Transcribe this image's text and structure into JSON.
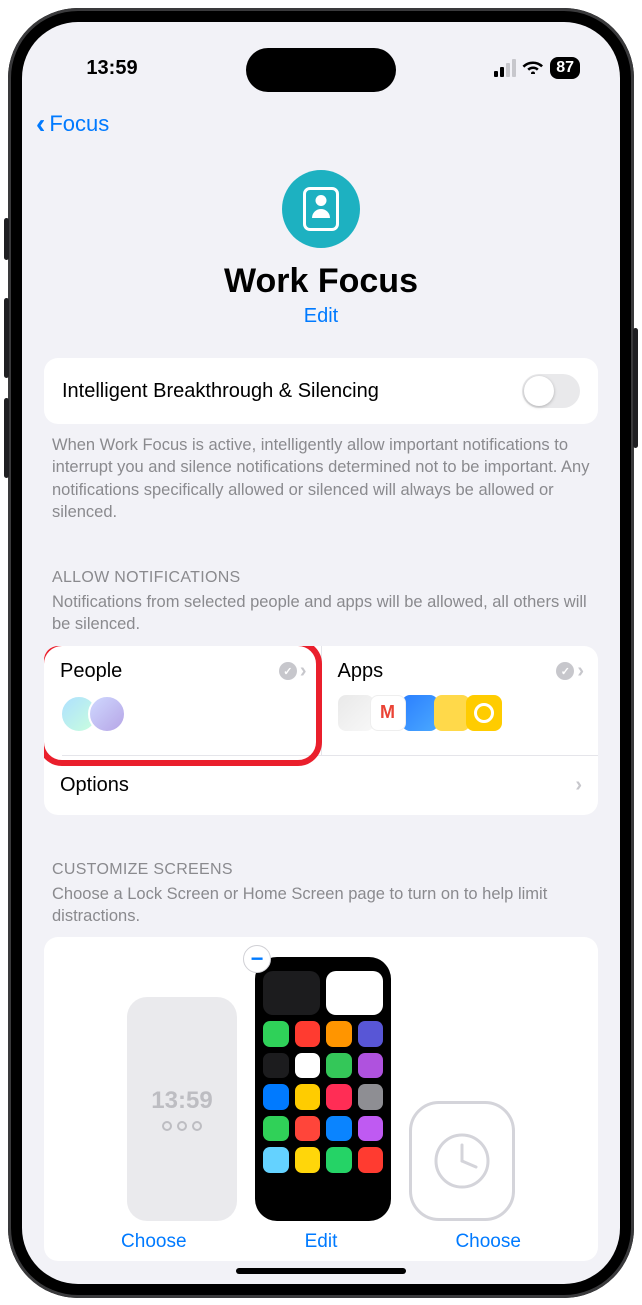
{
  "status": {
    "time": "13:59",
    "battery": "87"
  },
  "nav": {
    "back_label": "Focus"
  },
  "header": {
    "title": "Work Focus",
    "edit": "Edit"
  },
  "intelligent": {
    "label": "Intelligent Breakthrough & Silencing",
    "footer": "When Work Focus is active, intelligently allow important notifications to interrupt you and silence notifications determined not to be important. Any notifications specifically allowed or silenced will always be allowed or silenced."
  },
  "allow_section": {
    "header": "ALLOW NOTIFICATIONS",
    "desc": "Notifications from selected people and apps will be allowed, all others will be silenced.",
    "people_label": "People",
    "apps_label": "Apps",
    "options_label": "Options"
  },
  "customize_section": {
    "header": "CUSTOMIZE SCREENS",
    "desc": "Choose a Lock Screen or Home Screen page to turn on to help limit distractions.",
    "lock_time": "13:59",
    "choose1": "Choose",
    "edit_home": "Edit",
    "choose2": "Choose"
  }
}
